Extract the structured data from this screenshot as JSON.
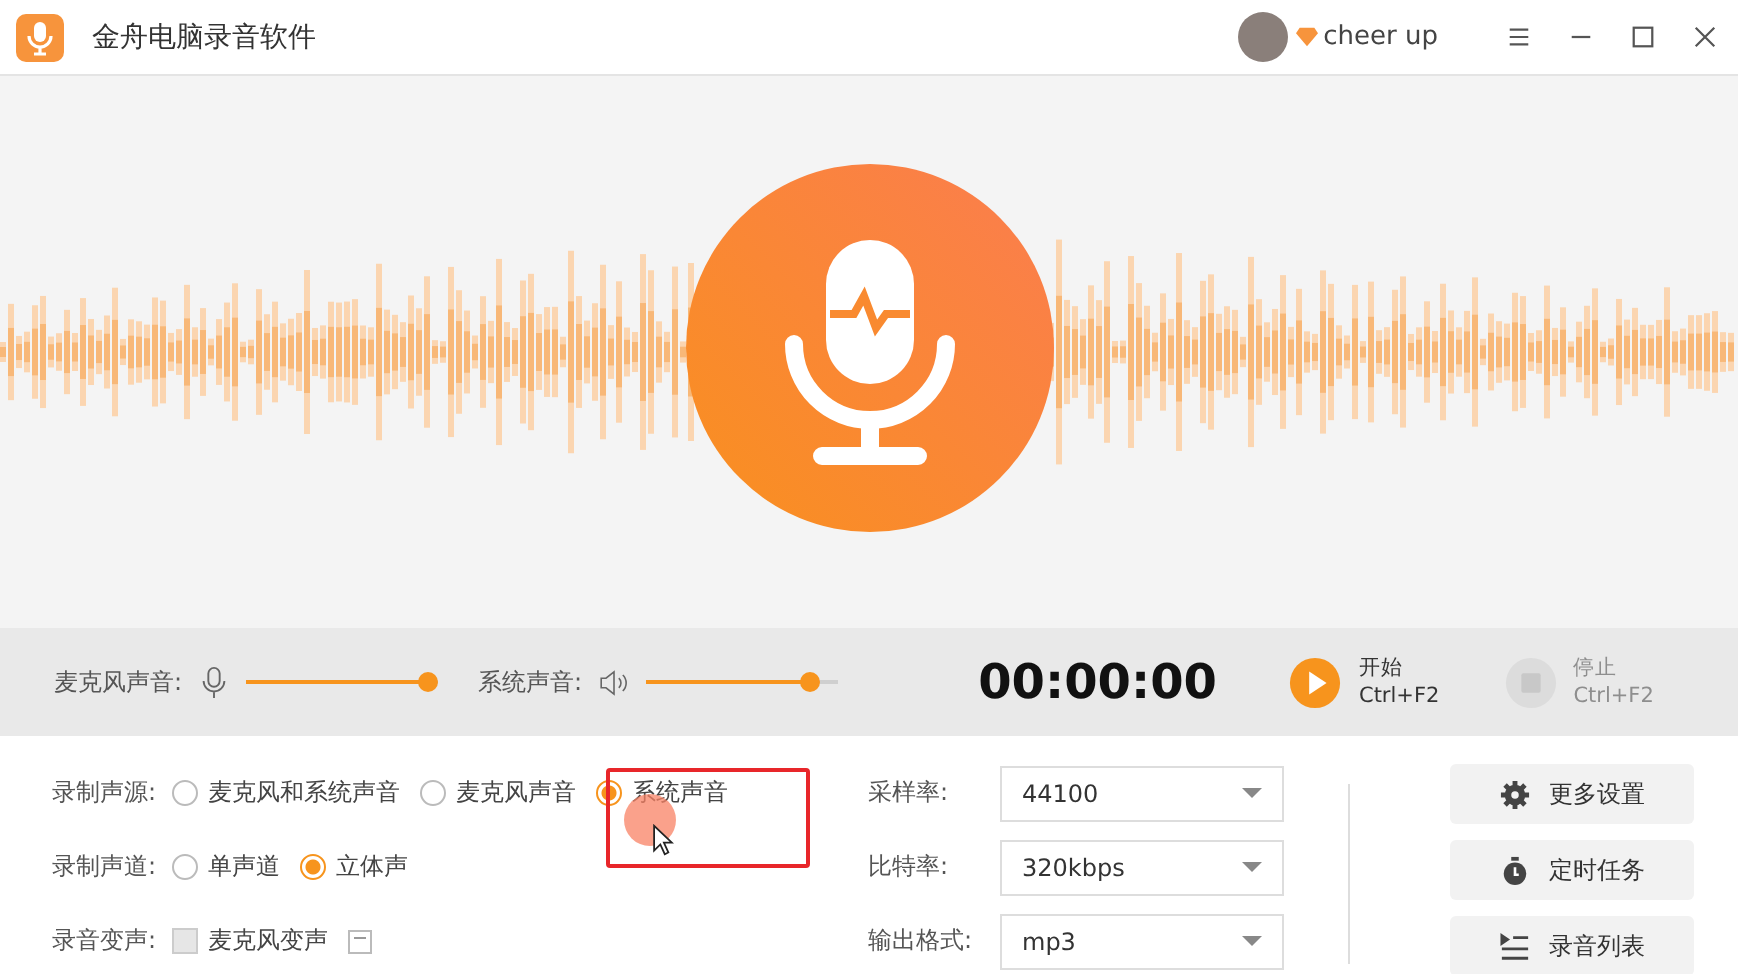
{
  "window": {
    "title": "金舟电脑录音软件",
    "user": "cheer up"
  },
  "levels": [
    {
      "label": "麦克风声音:",
      "kind": "mic",
      "level": 0.95
    },
    {
      "label": "系统声音:",
      "kind": "speaker",
      "level": 0.85
    }
  ],
  "timer": "00:00:00",
  "actions": [
    {
      "kind": "start",
      "label": "开始",
      "shortcut": "Ctrl+F2",
      "disabled": false
    },
    {
      "kind": "stop",
      "label": "停止",
      "shortcut": "Ctrl+F2",
      "disabled": true
    }
  ],
  "settings": [
    {
      "label": "录制声源:",
      "kind": "radio",
      "options": [
        {
          "label": "麦克风和系统声音",
          "selected": false
        },
        {
          "label": "麦克风声音",
          "selected": false
        },
        {
          "label": "系统声音",
          "selected": true
        }
      ]
    },
    {
      "label": "录制声道:",
      "kind": "radio",
      "options": [
        {
          "label": "单声道",
          "selected": false
        },
        {
          "label": "立体声",
          "selected": true
        }
      ]
    },
    {
      "label": "录音变声:",
      "kind": "checkbox",
      "options": [
        {
          "label": "麦克风变声",
          "checked": false
        }
      ]
    }
  ],
  "format": [
    {
      "label": "采样率:",
      "value": "44100"
    },
    {
      "label": "比特率:",
      "value": "320kbps"
    },
    {
      "label": "输出格式:",
      "value": "mp3"
    }
  ],
  "side_buttons": [
    {
      "kind": "gear",
      "label": "更多设置"
    },
    {
      "kind": "timer",
      "label": "定时任务"
    },
    {
      "kind": "list",
      "label": "录音列表"
    }
  ]
}
